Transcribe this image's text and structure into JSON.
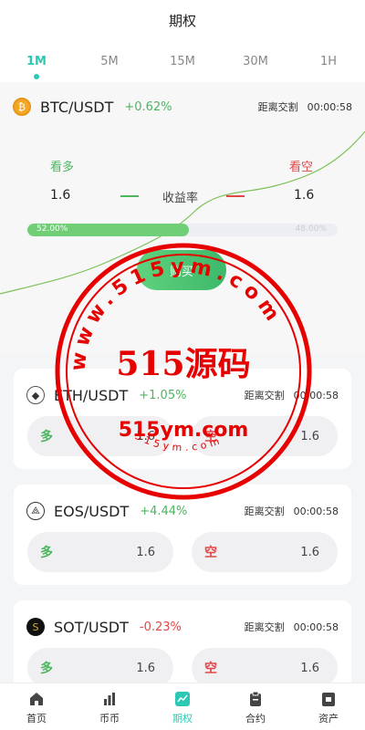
{
  "header": {
    "title": "期权"
  },
  "tabs": [
    {
      "label": "1M",
      "active": true
    },
    {
      "label": "5M",
      "active": false
    },
    {
      "label": "15M",
      "active": false
    },
    {
      "label": "30M",
      "active": false
    },
    {
      "label": "1H",
      "active": false
    }
  ],
  "main": {
    "pair": "BTC/USDT",
    "change": "+0.62%",
    "settle_label": "距离交割",
    "settle_time": "00:00:58",
    "long_label": "看多",
    "short_label": "看空",
    "long_rate": "1.6",
    "short_rate": "1.6",
    "rate_label": "收益率",
    "long_pct_text": "52.00%",
    "short_pct_text": "48.00%",
    "long_fraction": 0.52,
    "buy_label": "购买"
  },
  "pairs": [
    {
      "pair": "ETH/USDT",
      "change": "+1.05%",
      "dir": "up",
      "settle_label": "距离交割",
      "settle_time": "00:00:58",
      "long_label": "多",
      "long_val": "1.6",
      "short_label": "空",
      "short_val": "1.6",
      "icon": "eth-icon"
    },
    {
      "pair": "EOS/USDT",
      "change": "+4.44%",
      "dir": "up",
      "settle_label": "距离交割",
      "settle_time": "00:00:58",
      "long_label": "多",
      "long_val": "1.6",
      "short_label": "空",
      "short_val": "1.6",
      "icon": "eos-icon"
    },
    {
      "pair": "SOT/USDT",
      "change": "-0.23%",
      "dir": "down",
      "settle_label": "距离交割",
      "settle_time": "00:00:58",
      "long_label": "多",
      "long_val": "1.6",
      "short_label": "空",
      "short_val": "1.6",
      "icon": "sot-icon"
    }
  ],
  "tabbar": [
    {
      "label": "首页",
      "icon": "home-icon",
      "active": false
    },
    {
      "label": "币币",
      "icon": "bar-chart-icon",
      "active": false
    },
    {
      "label": "期权",
      "icon": "option-chart-icon",
      "active": true
    },
    {
      "label": "合约",
      "icon": "clipboard-icon",
      "active": false
    },
    {
      "label": "资产",
      "icon": "wallet-icon",
      "active": false
    }
  ],
  "watermark": {
    "ring_text": "www.515ym.com",
    "main_text": "515源码",
    "sub_text": "515ym.com",
    "bottom_text": "515ym.com"
  },
  "colors": {
    "accent": "#2dc8b4",
    "up": "#4cb65f",
    "down": "#e04848",
    "watermark": "#e60000"
  }
}
